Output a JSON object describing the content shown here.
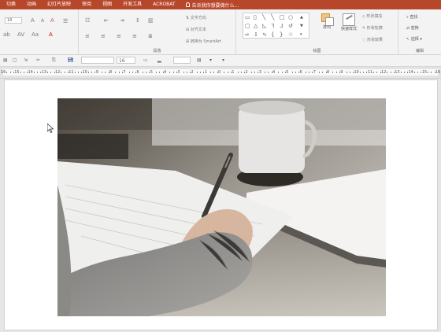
{
  "tabs": [
    "切换",
    "动画",
    "幻灯片放映",
    "审阅",
    "视图",
    "开发工具",
    "ACROBAT"
  ],
  "tell_me": "告诉我你想要做什么...",
  "font": {
    "size": "18",
    "grow": "A",
    "shrink": "A",
    "clear": "A"
  },
  "paragraph": {
    "text_direction": "文字方向",
    "align_text": "对齐文本",
    "smartart": "转换为 SmartArt",
    "label": "段落"
  },
  "drawing": {
    "arrange": "排列",
    "quick_styles": "快速样式",
    "shape_fill": "形状填充",
    "shape_outline": "形状轮廓",
    "shape_effects": "形状效果",
    "label": "绘图"
  },
  "editing": {
    "find": "查找",
    "replace": "替换",
    "select": "选择",
    "label": "编辑"
  },
  "toolbar2": {
    "font_size": "16"
  },
  "ruler": {
    "labels": [
      "16",
      "15",
      "14",
      "13",
      "12",
      "11",
      "10",
      "9",
      "8",
      "7",
      "6",
      "5",
      "4",
      "3",
      "2",
      "1",
      "0",
      "1",
      "2",
      "3",
      "4",
      "5",
      "6",
      "7",
      "8",
      "9",
      "10",
      "11",
      "12",
      "13",
      "14",
      "15",
      "16"
    ]
  }
}
